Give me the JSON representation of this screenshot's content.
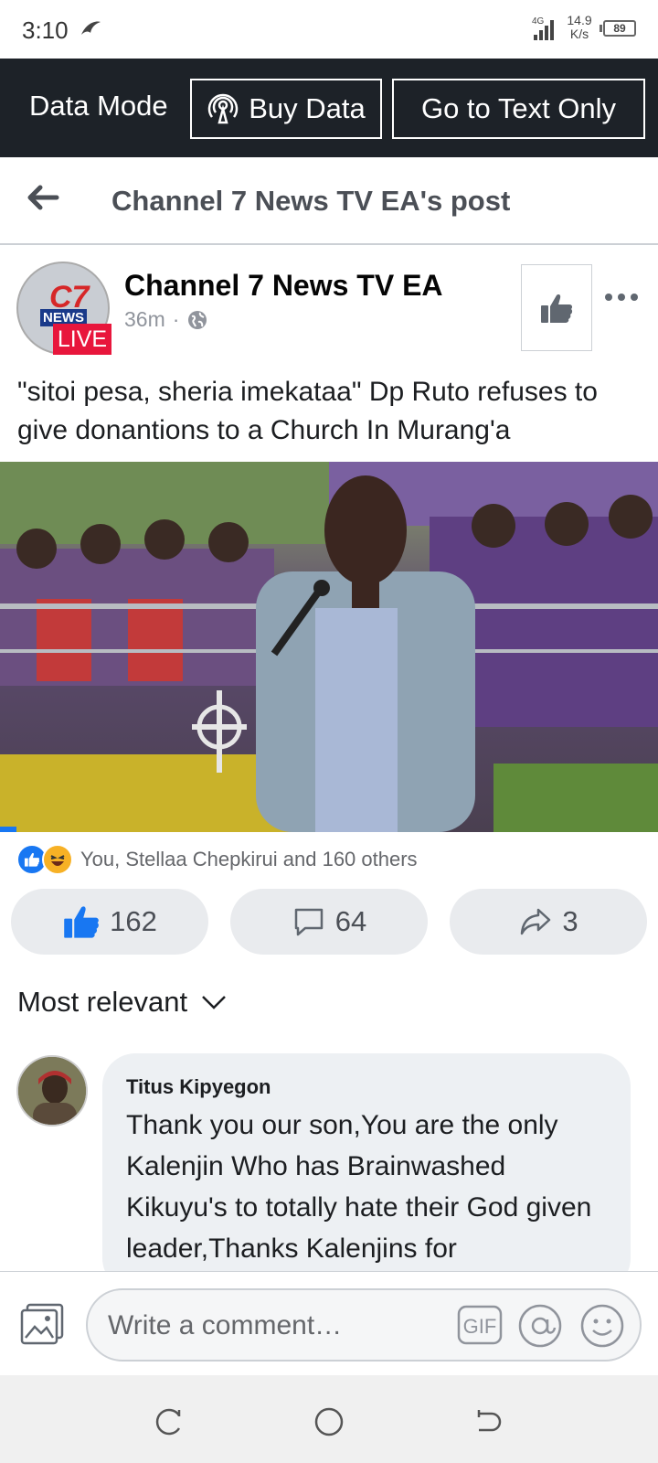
{
  "status_bar": {
    "time": "3:10",
    "network_type": "4G",
    "speed_value": "14.9",
    "speed_unit": "K/s",
    "battery": "89"
  },
  "data_bar": {
    "mode_label": "Data Mode",
    "buy_data_label": "Buy Data",
    "text_only_label": "Go to Text Only"
  },
  "header": {
    "title": "Channel 7 News TV EA's post"
  },
  "post": {
    "author": "Channel 7 News TV EA",
    "avatar_logo": "C7",
    "avatar_news": "NEWS",
    "live_badge": "LIVE",
    "time": "36m",
    "separator": "·",
    "text": "\"sitoi pesa, sheria imekataa\" Dp Ruto refuses to give donantions to a Church In Murang'a",
    "video_progress": 0.025
  },
  "reactions": {
    "summary": "You, Stellaa Chepkirui and 160 others"
  },
  "actions": {
    "like_count": "162",
    "comment_count": "64",
    "share_count": "3"
  },
  "sort": {
    "label": "Most relevant"
  },
  "comment": {
    "author": "Titus Kipyegon",
    "text": "Thank you our son,You are the only Kalenjin Who has Brainwashed Kikuyu's to totally hate their God given leader,Thanks Kalenjins for"
  },
  "composer": {
    "placeholder": "Write a comment…",
    "gif_label": "GIF"
  },
  "colors": {
    "accent": "#1877f2",
    "data_bar": "#1d2228",
    "live": "#e8163c",
    "bubble": "#edf0f3"
  }
}
